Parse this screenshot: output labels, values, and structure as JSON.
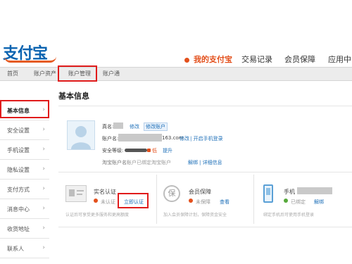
{
  "header": {
    "logo_text": "支付宝",
    "nav": [
      {
        "label": "我的支付宝",
        "active": true
      },
      {
        "label": "交易记录",
        "active": false
      },
      {
        "label": "会员保障",
        "active": false
      },
      {
        "label": "应用中心",
        "active": false
      }
    ]
  },
  "subnav": {
    "items": [
      "首页",
      "账户资产",
      "账户管理",
      "账户通"
    ]
  },
  "sidebar": {
    "items": [
      "基本信息",
      "安全设置",
      "手机设置",
      "隐私设置",
      "支付方式",
      "消息中心",
      "收货地址",
      "联系人"
    ]
  },
  "main": {
    "title": "基本信息",
    "profile": {
      "name_label": "真名:",
      "name_link": "修改",
      "name_badge": "修改账户",
      "account_label": "账户名:",
      "account_value": "163.com",
      "account_link1": "修改",
      "account_link2": "| 开启手机登录",
      "security_label": "安全等级:",
      "security_level": "低",
      "security_link": "提升",
      "taobao_label": "淘宝账户名:",
      "taobao_value": "账户已绑定淘宝账户",
      "taobao_link1": "解绑",
      "taobao_link2": "| 详细信息"
    },
    "cards": [
      {
        "title": "实名认证",
        "status": "未认证",
        "action": "立即认证",
        "desc": "认证后可享受更多服务和更高额度"
      },
      {
        "title": "会员保障",
        "status": "未保障",
        "action": "查看",
        "desc": "加入会员保障计划，保障资金安全"
      },
      {
        "title": "手机",
        "status": "已绑定",
        "action": "解绑",
        "desc": "绑定手机后可使用手机登录"
      }
    ]
  }
}
